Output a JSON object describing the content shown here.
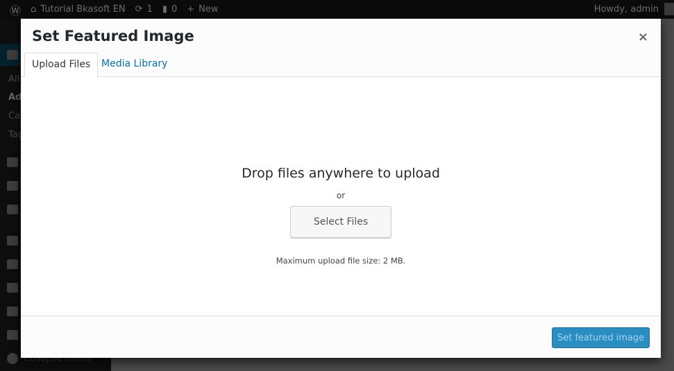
{
  "adminbar": {
    "site_name": "Tutorial Bkasoft EN",
    "updates": "1",
    "comments": "0",
    "new_label": "New",
    "howdy": "Howdy, admin"
  },
  "sidebar": {
    "sub_items": [
      "All",
      "Add",
      "Cat",
      "Tag"
    ],
    "collapse_label": "Collapse menu"
  },
  "modal": {
    "title": "Set Featured Image",
    "close_label": "×",
    "tabs": [
      {
        "label": "Upload Files",
        "active": true
      },
      {
        "label": "Media Library",
        "active": false
      }
    ],
    "drop_text": "Drop files anywhere to upload",
    "or_text": "or",
    "select_files_label": "Select Files",
    "max_size_text": "Maximum upload file size: 2 MB.",
    "primary_button_label": "Set featured image",
    "primary_button_disabled": true
  },
  "colors": {
    "accent": "#0073aa",
    "primary_button": "#2a8ec2"
  }
}
